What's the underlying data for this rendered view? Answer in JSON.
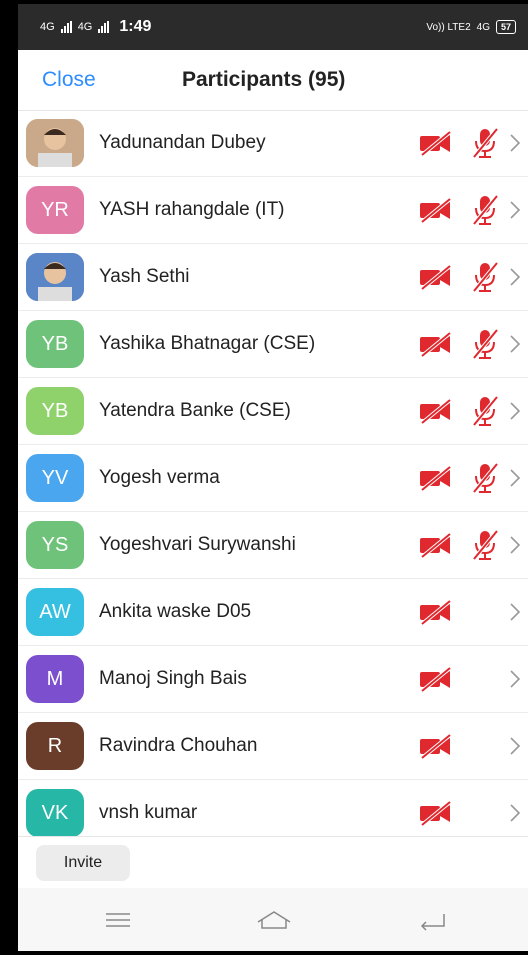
{
  "status_bar": {
    "signal1": "4G",
    "signal2": "4G",
    "time": "1:49",
    "volte": "Vo)) LTE2",
    "net": "4G",
    "battery": "57"
  },
  "header": {
    "close_label": "Close",
    "title": "Participants (95)"
  },
  "participants": [
    {
      "name": "Yadunandan Dubey",
      "initials": "",
      "avatar_color": "#c9a98a",
      "photo": true,
      "muted": true
    },
    {
      "name": "YASH rahangdale (IT)",
      "initials": "YR",
      "avatar_color": "#e27aa6",
      "photo": false,
      "muted": true
    },
    {
      "name": "Yash Sethi",
      "initials": "",
      "avatar_color": "#5a86c7",
      "photo": true,
      "muted": true
    },
    {
      "name": "Yashika Bhatnagar (CSE)",
      "initials": "YB",
      "avatar_color": "#6fc27a",
      "photo": false,
      "muted": true
    },
    {
      "name": "Yatendra Banke (CSE)",
      "initials": "YB",
      "avatar_color": "#8fd16a",
      "photo": false,
      "muted": true
    },
    {
      "name": "Yogesh verma",
      "initials": "YV",
      "avatar_color": "#4aa6ef",
      "photo": false,
      "muted": true
    },
    {
      "name": "Yogeshvari Surywanshi",
      "initials": "YS",
      "avatar_color": "#6fc27a",
      "photo": false,
      "muted": true
    },
    {
      "name": "Ankita waske D05",
      "initials": "AW",
      "avatar_color": "#35bfe0",
      "photo": false,
      "muted": false
    },
    {
      "name": "Manoj Singh Bais",
      "initials": "M",
      "avatar_color": "#7c4fce",
      "photo": false,
      "muted": false
    },
    {
      "name": "Ravindra Chouhan",
      "initials": "R",
      "avatar_color": "#6a3c2a",
      "photo": false,
      "muted": false
    },
    {
      "name": "vnsh kumar",
      "initials": "VK",
      "avatar_color": "#26b7a6",
      "photo": false,
      "muted": false
    }
  ],
  "bottom": {
    "invite_label": "Invite"
  },
  "icons": {
    "video_off": "video-off-icon",
    "mic_off": "mic-off-icon",
    "chevron": "chevron-right-icon",
    "nav_menu": "menu-icon",
    "nav_home": "home-icon",
    "nav_back": "back-icon"
  },
  "colors": {
    "accent": "#2d8cff",
    "muted_red": "#e0282f"
  }
}
